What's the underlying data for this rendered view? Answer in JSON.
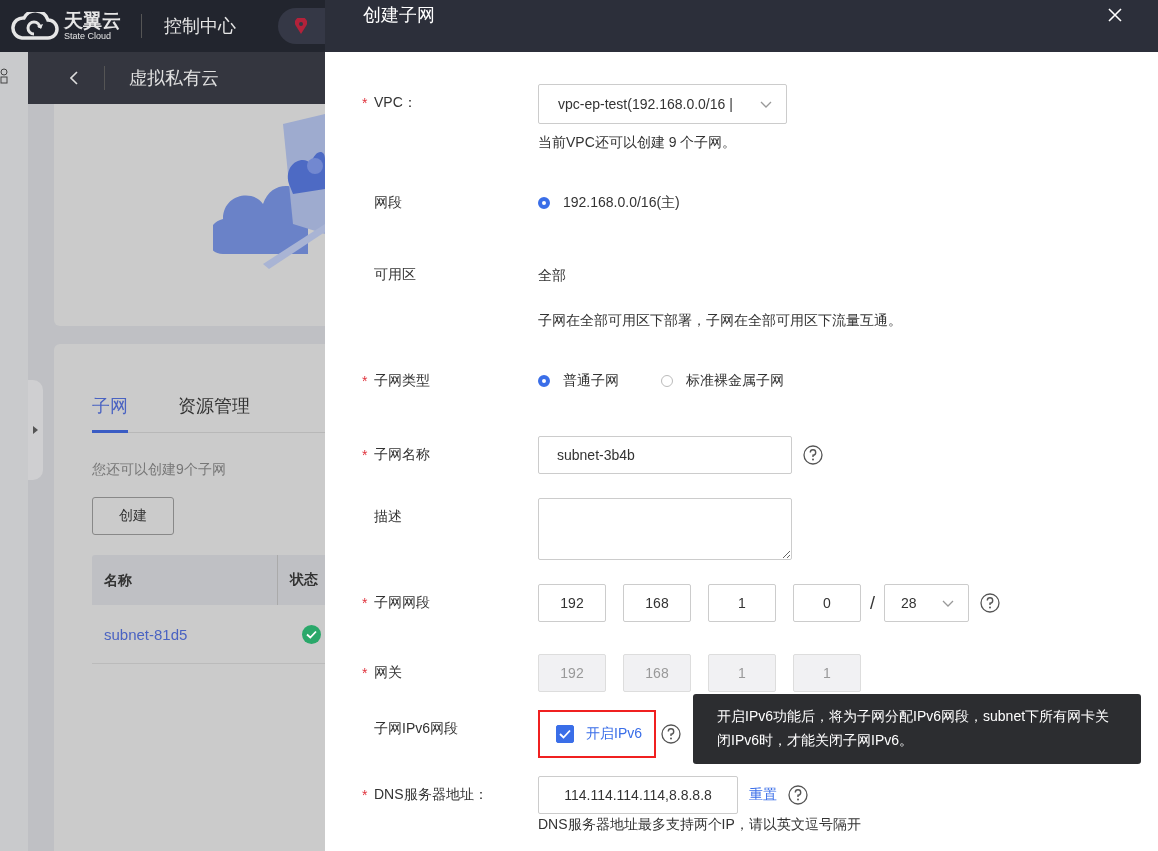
{
  "topbar": {
    "brand": "天翼云",
    "brand_sub": "State Cloud",
    "console": "控制中心"
  },
  "page": {
    "title": "虚拟私有云"
  },
  "tabs": [
    {
      "label": "子网",
      "selected": true
    },
    {
      "label": "资源管理",
      "selected": false
    }
  ],
  "quota_note": "您还可以创建9个子网",
  "create_button": "创建",
  "table": {
    "columns": [
      "名称",
      "状态"
    ],
    "rows": [
      {
        "name": "subnet-81d5"
      }
    ]
  },
  "drawer": {
    "title": "创建子网",
    "vpc": {
      "required_mark": "*",
      "label": "VPC：",
      "value": "vpc-ep-test(192.168.0.0/16 |",
      "hint": "当前VPC还可以创建 9 个子网。"
    },
    "cidr": {
      "label": "网段",
      "options": [
        {
          "label": "192.168.0.0/16(主)",
          "selected": true
        }
      ]
    },
    "zone": {
      "label": "可用区",
      "value": "全部",
      "hint": "子网在全部可用区下部署，子网在全部可用区下流量互通。"
    },
    "type": {
      "required_mark": "*",
      "label": "子网类型",
      "options": [
        {
          "label": "普通子网",
          "selected": true
        },
        {
          "label": "标准裸金属子网",
          "selected": false
        }
      ]
    },
    "name": {
      "required_mark": "*",
      "label": "子网名称",
      "value": "subnet-3b4b"
    },
    "desc": {
      "label": "描述"
    },
    "segment": {
      "required_mark": "*",
      "label": "子网网段",
      "octets": [
        "192",
        "168",
        "1",
        "0"
      ],
      "separator": "/",
      "mask": "28"
    },
    "gateway": {
      "required_mark": "*",
      "label": "网关",
      "octets": [
        "192",
        "168",
        "1",
        "1"
      ],
      "disabled": true
    },
    "ipv6": {
      "label": "子网IPv6网段",
      "checkbox_label": "开启IPv6",
      "checked": true,
      "highlighted": true,
      "tooltip": "开启IPv6功能后，将为子网分配IPv6网段，subnet下所有网卡关闭IPv6时，才能关闭子网IPv6。"
    },
    "dns": {
      "required_mark": "*",
      "label": "DNS服务器地址：",
      "value": "114.114.114.114,8.8.8.8",
      "link": "重置",
      "hint": "DNS服务器地址最多支持两个IP，请以英文逗号隔开"
    }
  }
}
